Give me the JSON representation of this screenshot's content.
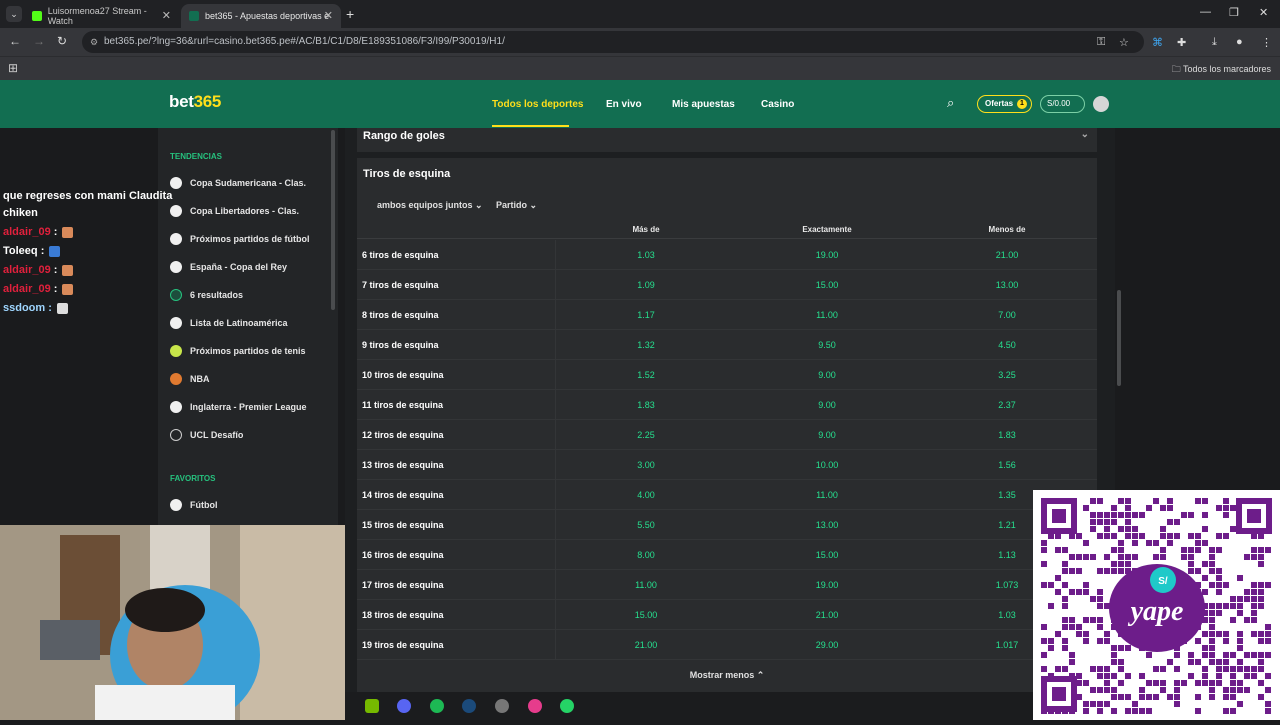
{
  "browser": {
    "tabs": [
      {
        "title": "Luisormenoa27 Stream - Watch"
      },
      {
        "title": "bet365 - Apuestas deportivas e"
      }
    ],
    "url": "bet365.pe/?lng=36&rurl=casino.bet365.pe#/AC/B1/C1/D8/E189351086/F3/I99/P30019/H1/",
    "bookmarks_label": "Todos los marcadores"
  },
  "site": {
    "logo": {
      "text": "bet",
      "num": "365"
    },
    "nav": [
      "Todos los deportes",
      "En vivo",
      "Mis apuestas",
      "Casino"
    ],
    "offers_label": "Ofertas",
    "offers_count": "1",
    "balance": "S/0.00"
  },
  "sidebar": {
    "trending_heading": "TENDENCIAS",
    "trending": [
      "Copa Sudamericana - Clas.",
      "Copa Libertadores - Clas.",
      "Próximos partidos de fútbol",
      "España - Copa del Rey",
      "6 resultados",
      "Lista de Latinoamérica",
      "Próximos partidos de tenis",
      "NBA",
      "Inglaterra - Premier League",
      "UCL Desafío"
    ],
    "favorites_heading": "FAVORITOS",
    "favorites": [
      "Fútbol"
    ]
  },
  "market": {
    "collapsed_title": "Rango de goles",
    "title": "Tiros de esquina",
    "filters": [
      "ambos equipos juntos",
      "Partido"
    ],
    "columns": [
      "Más de",
      "Exactamente",
      "Menos de"
    ],
    "rows": [
      {
        "label": "6 tiros de esquina",
        "over": "1.03",
        "exact": "19.00",
        "under": "21.00"
      },
      {
        "label": "7 tiros de esquina",
        "over": "1.09",
        "exact": "15.00",
        "under": "13.00"
      },
      {
        "label": "8 tiros de esquina",
        "over": "1.17",
        "exact": "11.00",
        "under": "7.00"
      },
      {
        "label": "9 tiros de esquina",
        "over": "1.32",
        "exact": "9.50",
        "under": "4.50"
      },
      {
        "label": "10 tiros de esquina",
        "over": "1.52",
        "exact": "9.00",
        "under": "3.25"
      },
      {
        "label": "11 tiros de esquina",
        "over": "1.83",
        "exact": "9.00",
        "under": "2.37"
      },
      {
        "label": "12 tiros de esquina",
        "over": "2.25",
        "exact": "9.00",
        "under": "1.83"
      },
      {
        "label": "13 tiros de esquina",
        "over": "3.00",
        "exact": "10.00",
        "under": "1.56"
      },
      {
        "label": "14 tiros de esquina",
        "over": "4.00",
        "exact": "11.00",
        "under": "1.35"
      },
      {
        "label": "15 tiros de esquina",
        "over": "5.50",
        "exact": "13.00",
        "under": "1.21"
      },
      {
        "label": "16 tiros de esquina",
        "over": "8.00",
        "exact": "15.00",
        "under": "1.13"
      },
      {
        "label": "17 tiros de esquina",
        "over": "11.00",
        "exact": "19.00",
        "under": "1.073"
      },
      {
        "label": "18 tiros de esquina",
        "over": "15.00",
        "exact": "21.00",
        "under": "1.03"
      },
      {
        "label": "19 tiros de esquina",
        "over": "21.00",
        "exact": "29.00",
        "under": "1.017"
      }
    ],
    "show_less": "Mostrar menos"
  },
  "chat": {
    "lines": [
      {
        "name": "",
        "text": "que regreses con mami Claudita"
      },
      {
        "name": "",
        "text": "chiken"
      },
      {
        "name": "aldair_09",
        "text": " : "
      },
      {
        "name": "Toleeq",
        "text": " : "
      },
      {
        "name": "aldair_09",
        "text": " : "
      },
      {
        "name": "aldair_09",
        "text": " : "
      },
      {
        "name": "ssdoom",
        "text": " : "
      }
    ]
  },
  "qr": {
    "brand": "yape",
    "symbol": "S/"
  },
  "colors": {
    "brand_green": "#126e51",
    "odds_green": "#26e08f",
    "accent_yellow": "#ffdf1b"
  }
}
